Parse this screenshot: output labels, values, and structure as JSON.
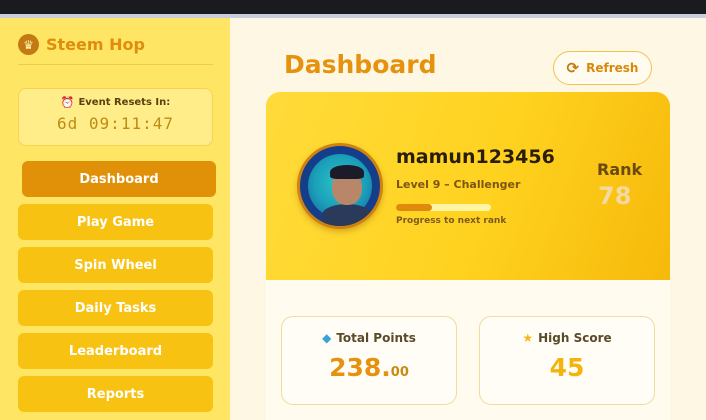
{
  "brand": {
    "logo_icon": "crown-icon",
    "name": "Steem Hop"
  },
  "event_reset": {
    "title": "Event Resets In:",
    "timer": "6d 09:11:47"
  },
  "nav": {
    "items": [
      {
        "label": "Dashboard",
        "active": true
      },
      {
        "label": "Play Game",
        "active": false
      },
      {
        "label": "Spin Wheel",
        "active": false
      },
      {
        "label": "Daily Tasks",
        "active": false
      },
      {
        "label": "Leaderboard",
        "active": false
      },
      {
        "label": "Reports",
        "active": false
      }
    ]
  },
  "header": {
    "title": "Dashboard",
    "refresh_label": "Refresh"
  },
  "profile": {
    "username": "mamun123456",
    "level": "Level 9 – Challenger",
    "progress_fraction": 0.38,
    "progress_label": "Progress to next rank",
    "rank_label": "Rank",
    "rank_value": "78"
  },
  "stats": {
    "total_points": {
      "label": "Total Points",
      "value_int": "238.",
      "value_dec": "00"
    },
    "high_score": {
      "label": "High Score",
      "value": "45"
    }
  },
  "colors": {
    "accent": "#e6920e",
    "sidebar": "#ffe564",
    "nav_button": "#f8c213",
    "nav_active": "#e09108",
    "card_gradient_start": "#ffdb3a",
    "card_gradient_end": "#f6b90a"
  }
}
